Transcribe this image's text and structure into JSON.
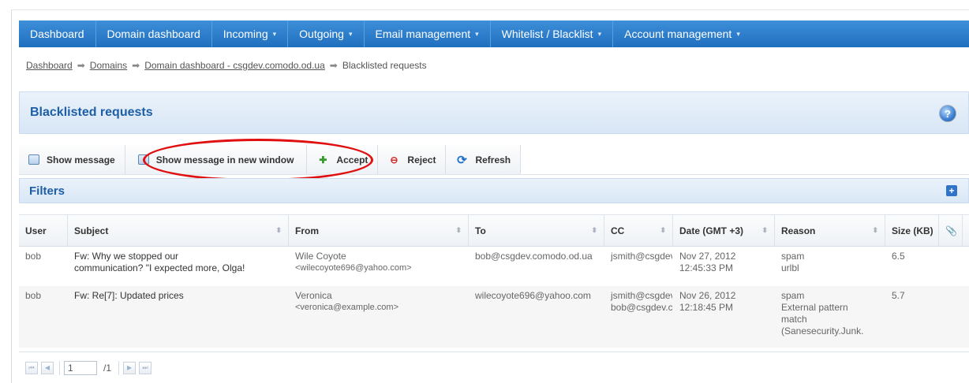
{
  "nav": {
    "items": [
      {
        "label": "Dashboard",
        "dropdown": false
      },
      {
        "label": "Domain dashboard",
        "dropdown": false
      },
      {
        "label": "Incoming",
        "dropdown": true
      },
      {
        "label": "Outgoing",
        "dropdown": true
      },
      {
        "label": "Email management",
        "dropdown": true
      },
      {
        "label": "Whitelist / Blacklist",
        "dropdown": true
      },
      {
        "label": "Account management",
        "dropdown": true
      }
    ],
    "caret": "▾",
    "bar_color": "#2a7bcc"
  },
  "breadcrumb": {
    "items": [
      "Dashboard",
      "Domains",
      "Domain dashboard - csgdev.comodo.od.ua"
    ],
    "current": "Blacklisted requests",
    "arrow": "➡"
  },
  "page": {
    "title": "Blacklisted requests",
    "help_icon": "?"
  },
  "toolbar": {
    "show_message": "Show message",
    "show_message_new_window": "Show message in new window",
    "accept": "Accept",
    "reject": "Reject",
    "refresh": "Refresh",
    "highlight_color": "#e01010"
  },
  "filters": {
    "title": "Filters",
    "expand_icon": "+"
  },
  "table": {
    "columns": [
      "User",
      "Subject",
      "From",
      "To",
      "CC",
      "Date (GMT +3)",
      "Reason",
      "Size (KB)",
      "📎"
    ],
    "rows": [
      {
        "user": "bob",
        "subject": [
          "Fw: Why we stopped our",
          "communication? \"I expected more, Olga!"
        ],
        "from": [
          "Wile Coyote",
          "<wilecoyote696@yahoo.com>"
        ],
        "to": [
          "bob@csgdev.comodo.od.ua"
        ],
        "cc": [
          "jsmith@csgdev.comodo.od.ua"
        ],
        "date": [
          "Nov 27, 2012",
          "12:45:33 PM"
        ],
        "reason": [
          "spam",
          "urlbl"
        ],
        "size": "6.5"
      },
      {
        "user": "bob",
        "subject": [
          "Fw: Re[7]: Updated prices"
        ],
        "from": [
          "Veronica",
          "<veronica@example.com>"
        ],
        "to": [
          "wilecoyote696@yahoo.com"
        ],
        "cc": [
          "jsmith@csgdev.comodo.od.ua",
          "bob@csgdev.comodo.od.ua"
        ],
        "date": [
          "Nov 26, 2012",
          "12:18:45 PM"
        ],
        "reason": [
          "spam",
          "External pattern",
          "match",
          "(Sanesecurity.Junk."
        ],
        "size": "5.7"
      }
    ]
  },
  "pager": {
    "page": "1",
    "total": "/1",
    "first": "⏮",
    "prev": "◀",
    "next": "▶",
    "last": "⏭"
  }
}
